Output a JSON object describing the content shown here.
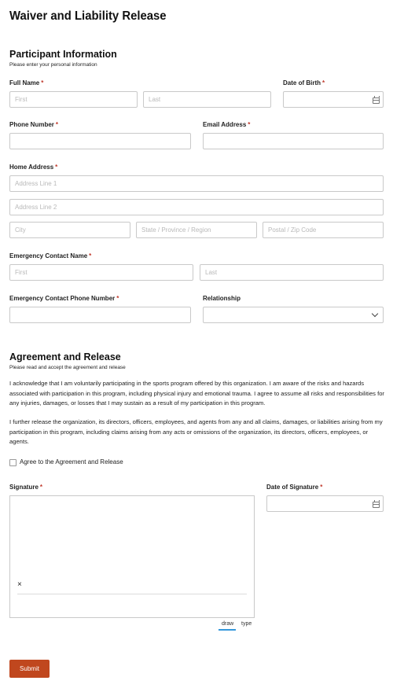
{
  "page_title": "Waiver and Liability Release",
  "participant": {
    "title": "Participant Information",
    "subtitle": "Please enter your personal information",
    "full_name_label": "Full Name",
    "first_placeholder": "First",
    "last_placeholder": "Last",
    "dob_label": "Date of Birth",
    "phone_label": "Phone Number",
    "email_label": "Email Address",
    "home_address_label": "Home Address",
    "address1_placeholder": "Address Line 1",
    "address2_placeholder": "Address Line 2",
    "city_placeholder": "City",
    "state_placeholder": "State / Province / Region",
    "zip_placeholder": "Postal / Zip Code",
    "emergency_name_label": "Emergency Contact Name",
    "emergency_phone_label": "Emergency Contact Phone Number",
    "relationship_label": "Relationship",
    "required_mark": "*"
  },
  "agreement": {
    "title": "Agreement and Release",
    "subtitle": "Please read and accept the agreement and release",
    "paragraph1": "I acknowledge that I am voluntarily participating in the sports program offered by this organization. I am aware of the risks and hazards associated with participation in this program, including physical injury and emotional trauma. I agree to assume all risks and responsibilities for any injuries, damages, or losses that I may sustain as a result of my participation in this program.",
    "paragraph2": "I further release the organization, its directors, officers, employees, and agents from any and all claims, damages, or liabilities arising from my participation in this program, including claims arising from any acts or omissions of the organization, its directors, officers, employees, or agents.",
    "checkbox_label": "Agree to the Agreement and Release",
    "signature_label": "Signature",
    "signature_x": "×",
    "date_of_signature_label": "Date of Signature",
    "tab_draw": "draw",
    "tab_type": "type"
  },
  "submit_label": "Submit",
  "colors": {
    "accent": "#c0471e",
    "required": "#c0392b",
    "tab_active": "#3498db"
  }
}
